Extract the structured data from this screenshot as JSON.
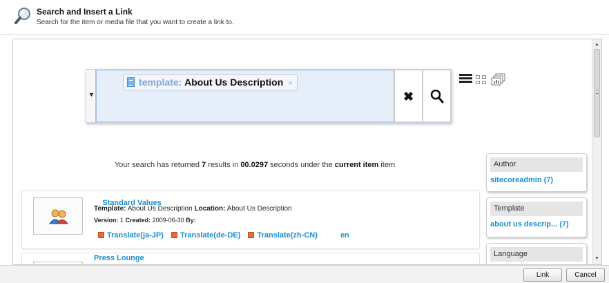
{
  "header": {
    "icon": "magnifier-icon",
    "title": "Search and Insert a Link",
    "subtitle": "Search for the item or media file that you want to create a link to."
  },
  "search": {
    "token_key": "template:",
    "token_value": "About Us Description",
    "token_remove": "×",
    "clear_glyph": "✖",
    "dropdown_glyph": "▼"
  },
  "view_icons": [
    "list-view-icon",
    "grid-view-icon",
    "detail-view-icon"
  ],
  "summary": {
    "prefix": "Your search has returned",
    "count": "7",
    "mid": "results in",
    "seconds": "00.0297",
    "mid2": "seconds under the",
    "scope": "current item",
    "suffix": "item"
  },
  "results": [
    {
      "title": "__Standard Values",
      "template_label": "Template:",
      "template_value": "About Us Description",
      "location_label": "Location:",
      "location_value": "About Us Description",
      "version_label": "Version:",
      "version_value": "1",
      "created_label": "Created:",
      "created_value": "2009-06-30",
      "by_label": "By:",
      "languages": [
        "Translate(ja-JP)",
        "Translate(de-DE)",
        "Translate(zh-CN)"
      ],
      "current_language": "en"
    },
    {
      "title": "Press Lounge"
    }
  ],
  "facets": [
    {
      "name": "Author",
      "value": "sitecoreadmin (7)"
    },
    {
      "name": "Template",
      "value": "about us descrip... (7)"
    },
    {
      "name": "Language",
      "value": ""
    }
  ],
  "footer": {
    "link_label": "Link",
    "cancel_label": "Cancel"
  },
  "colors": {
    "link_blue": "#1a8fce",
    "search_bg": "#e6eef9",
    "flag_orange": "#e8683a"
  }
}
